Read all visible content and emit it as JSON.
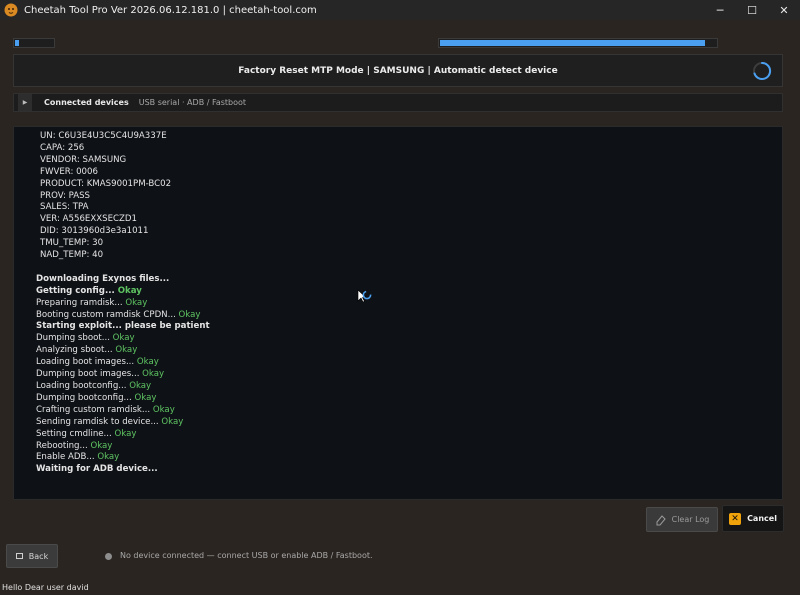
{
  "window": {
    "title": "Cheetah Tool Pro Ver 2026.06.12.181.0 | cheetah-tool.com",
    "minimize": "─",
    "maximize": "☐",
    "close": "✕"
  },
  "progress": {
    "left_fill": 0.1,
    "right_fill": 0.96
  },
  "mode_bar": {
    "text": "Factory Reset MTP Mode | SAMSUNG | Automatic detect device"
  },
  "devices": {
    "title": "Connected devices",
    "subtitle": "USB serial · ADB / Fastboot"
  },
  "log": {
    "info_lines": [
      "UN: C6U3E4U3C5C4U9A337E",
      "CAPA: 256",
      "VENDOR: SAMSUNG",
      "FWVER: 0006",
      "PRODUCT: KMAS9001PM-BC02",
      "PROV: PASS",
      "SALES: TPA",
      "VER: A556EXXSECZD1",
      "DID: 3013960d3e3a1011",
      "TMU_TEMP: 30",
      "NAD_TEMP: 40"
    ],
    "steps": [
      {
        "text": "Downloading Exynos files...",
        "ok": "",
        "bold": true
      },
      {
        "text": "Getting config... ",
        "ok": "Okay",
        "bold": true
      },
      {
        "text": "Preparing ramdisk... ",
        "ok": "Okay",
        "bold": false
      },
      {
        "text": "Booting custom ramdisk CPDN... ",
        "ok": "Okay",
        "bold": false
      },
      {
        "text": "Starting exploit... please be patient",
        "ok": "",
        "bold": true
      },
      {
        "text": "Dumping sboot... ",
        "ok": "Okay",
        "bold": false
      },
      {
        "text": "Analyzing sboot... ",
        "ok": "Okay",
        "bold": false
      },
      {
        "text": "Loading boot images... ",
        "ok": "Okay",
        "bold": false
      },
      {
        "text": "Dumping boot images... ",
        "ok": "Okay",
        "bold": false
      },
      {
        "text": "Loading bootconfig... ",
        "ok": "Okay",
        "bold": false
      },
      {
        "text": "Dumping bootconfig... ",
        "ok": "Okay",
        "bold": false
      },
      {
        "text": "Crafting custom ramdisk... ",
        "ok": "Okay",
        "bold": false
      },
      {
        "text": "Sending ramdisk to device... ",
        "ok": "Okay",
        "bold": false
      },
      {
        "text": "Setting cmdline... ",
        "ok": "Okay",
        "bold": false
      },
      {
        "text": "Rebooting... ",
        "ok": "Okay",
        "bold": false
      },
      {
        "text": "Enable ADB... ",
        "ok": "Okay",
        "bold": false
      },
      {
        "text": "Waiting for ADB device...",
        "ok": "",
        "bold": true
      }
    ]
  },
  "buttons": {
    "clear_log": "Clear Log",
    "cancel": "Cancel",
    "back": "Back"
  },
  "status": {
    "text": "No device connected — connect USB or enable ADB / Fastboot."
  },
  "footer": {
    "greeting": "Hello Dear user david"
  },
  "colors": {
    "accent": "#4a9ff0",
    "okay": "#5ec462",
    "cancel_icon": "#f0a30a"
  }
}
